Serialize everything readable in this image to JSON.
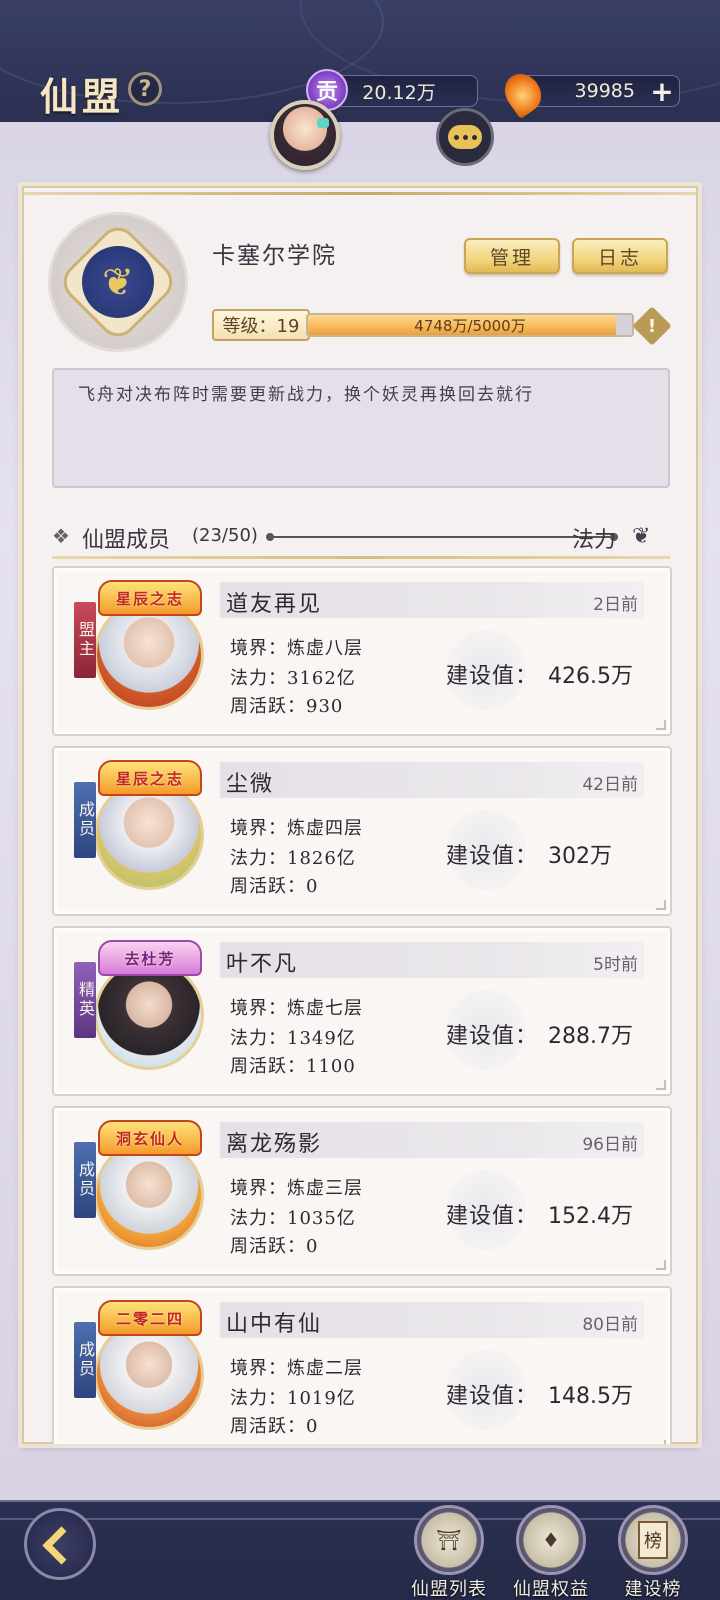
{
  "header": {
    "title": "仙盟",
    "help_icon": "?",
    "contribution": "20.12万",
    "contribution_icon": "贡",
    "spirit_stones": "39985",
    "plus_icon": "+"
  },
  "guild": {
    "name": "卡塞尔学院",
    "manage_label": "管理",
    "log_label": "日志",
    "level_label": "等级：19",
    "progress_text": "4748万/5000万",
    "progress_fraction": 0.9496,
    "warn_icon": "!",
    "notice": "飞舟对决布阵时需要更新战力，换个妖灵再换回去就行"
  },
  "members_section": {
    "title": "仙盟成员",
    "count": "(23/50)",
    "sort_label": "法力"
  },
  "members": [
    {
      "rank": "盟主",
      "badge": "星辰之志",
      "name": "道友再见",
      "last_seen": "2日前",
      "realm": "境界：炼虚八层",
      "power": "法力：3162亿",
      "weekly": "周活跃：930",
      "build_label": "建设值：",
      "build_value": "426.5万"
    },
    {
      "rank": "成员",
      "badge": "星辰之志",
      "name": "尘微",
      "last_seen": "42日前",
      "realm": "境界：炼虚四层",
      "power": "法力：1826亿",
      "weekly": "周活跃：0",
      "build_label": "建设值：",
      "build_value": "302万"
    },
    {
      "rank": "精英",
      "badge": "去杜芳",
      "name": "叶不凡",
      "last_seen": "5时前",
      "realm": "境界：炼虚七层",
      "power": "法力：1349亿",
      "weekly": "周活跃：1100",
      "build_label": "建设值：",
      "build_value": "288.7万"
    },
    {
      "rank": "成员",
      "badge": "洞玄仙人",
      "name": "离龙殇影",
      "last_seen": "96日前",
      "realm": "境界：炼虚三层",
      "power": "法力：1035亿",
      "weekly": "周活跃：0",
      "build_label": "建设值：",
      "build_value": "152.4万"
    },
    {
      "rank": "成员",
      "badge": "二零二四",
      "name": "山中有仙",
      "last_seen": "80日前",
      "realm": "境界：炼虚二层",
      "power": "法力：1019亿",
      "weekly": "周活跃：0",
      "build_label": "建设值：",
      "build_value": "148.5万"
    }
  ],
  "bottom_nav": {
    "list_label": "仙盟列表",
    "benefit_label": "仙盟权益",
    "rank_label": "建设榜",
    "rank_icon_char": "榜"
  }
}
